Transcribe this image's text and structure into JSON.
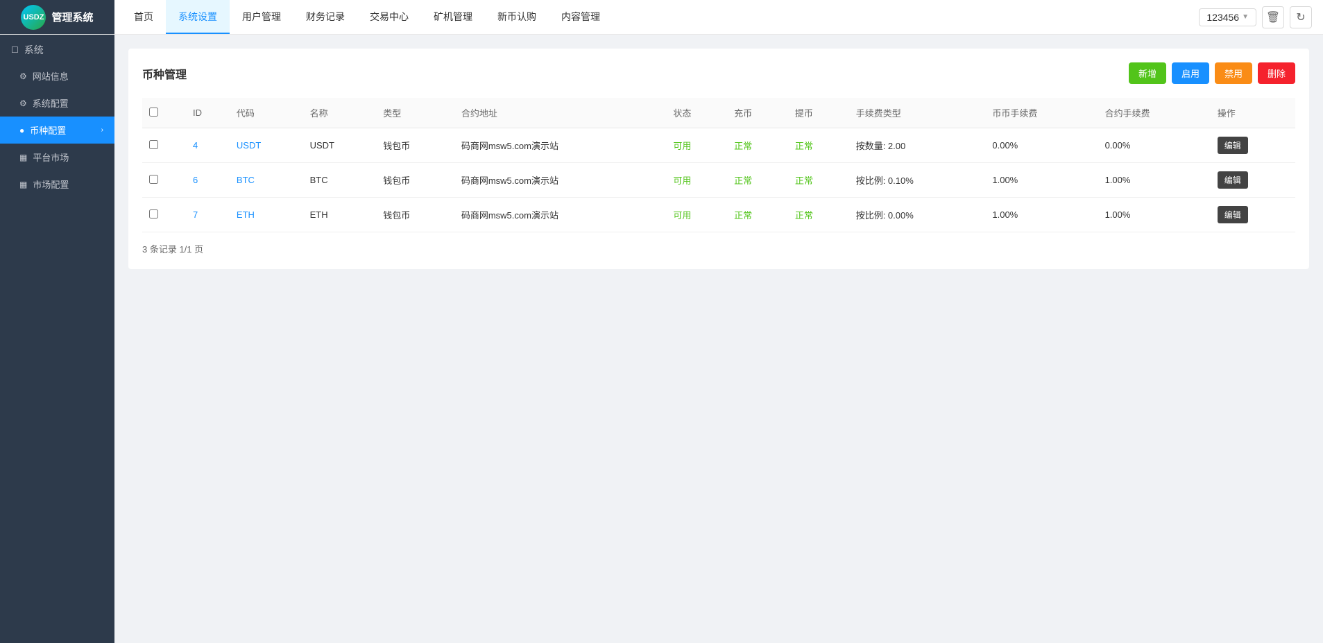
{
  "logo": {
    "icon_text": "USDZ",
    "title": "管理系统"
  },
  "top_nav": {
    "items": [
      {
        "label": "首页",
        "active": false
      },
      {
        "label": "系统设置",
        "active": true
      },
      {
        "label": "用户管理",
        "active": false
      },
      {
        "label": "财务记录",
        "active": false
      },
      {
        "label": "交易中心",
        "active": false
      },
      {
        "label": "矿机管理",
        "active": false
      },
      {
        "label": "新币认购",
        "active": false
      },
      {
        "label": "内容管理",
        "active": false
      }
    ],
    "user": "123456",
    "delete_icon": "🗑",
    "refresh_icon": "↻"
  },
  "sidebar": {
    "section_label": "系统",
    "items": [
      {
        "label": "网站信息",
        "icon": "⚙",
        "active": false,
        "has_sub": false
      },
      {
        "label": "系统配置",
        "icon": "⚙",
        "active": false,
        "has_sub": false
      },
      {
        "label": "币种配置",
        "icon": "●",
        "active": true,
        "has_sub": true
      },
      {
        "label": "平台市场",
        "icon": "📊",
        "active": false,
        "has_sub": false
      },
      {
        "label": "市场配置",
        "icon": "📊",
        "active": false,
        "has_sub": false
      }
    ]
  },
  "page": {
    "title": "币种管理",
    "buttons": {
      "add": "新增",
      "enable": "启用",
      "disable": "禁用",
      "delete": "删除"
    },
    "table": {
      "columns": [
        "",
        "ID",
        "代码",
        "名称",
        "类型",
        "合约地址",
        "状态",
        "充币",
        "提币",
        "手续费类型",
        "币币手续费",
        "合约手续费",
        "操作"
      ],
      "rows": [
        {
          "id": "4",
          "code": "USDT",
          "name": "USDT",
          "type": "钱包币",
          "contract": "码商网msw5.com演示站",
          "status": "可用",
          "recharge": "正常",
          "withdraw": "正常",
          "fee_type": "按数量: 2.00",
          "coin_fee": "0.00%",
          "contract_fee": "0.00%",
          "action": "编辑"
        },
        {
          "id": "6",
          "code": "BTC",
          "name": "BTC",
          "type": "钱包币",
          "contract": "码商网msw5.com演示站",
          "status": "可用",
          "recharge": "正常",
          "withdraw": "正常",
          "fee_type": "按比例: 0.10%",
          "coin_fee": "1.00%",
          "contract_fee": "1.00%",
          "action": "编辑"
        },
        {
          "id": "7",
          "code": "ETH",
          "name": "ETH",
          "type": "钱包币",
          "contract": "码商网msw5.com演示站",
          "status": "可用",
          "recharge": "正常",
          "withdraw": "正常",
          "fee_type": "按比例: 0.00%",
          "coin_fee": "1.00%",
          "contract_fee": "1.00%",
          "action": "编辑"
        }
      ]
    },
    "pagination": "3 条记录 1/1 页"
  }
}
